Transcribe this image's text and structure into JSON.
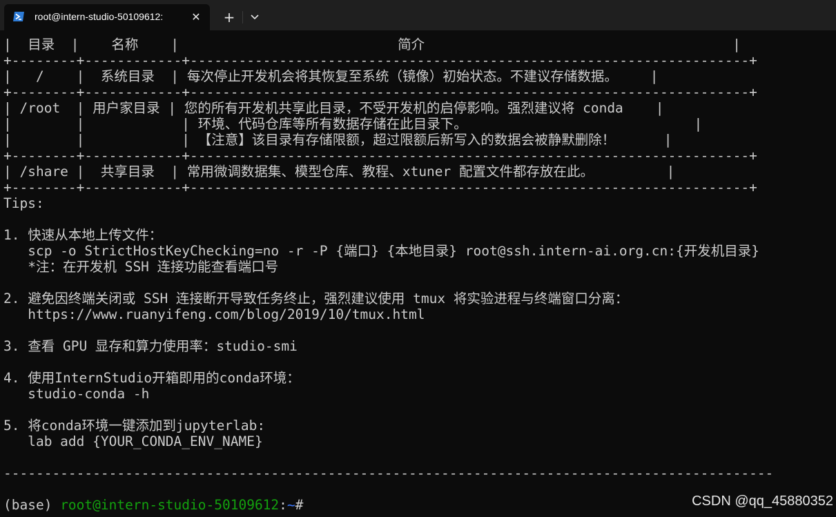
{
  "tab": {
    "icon": "powershell-icon",
    "title": "root@intern-studio-50109612:",
    "close": "✕",
    "new_tab": "+",
    "dropdown_icon": "chevron-down-icon"
  },
  "terminal": {
    "lines": [
      "|  目录  |    名称    |                           简介                                      |",
      "+--------+------------+---------------------------------------------------------------------+",
      "|   /    |  系统目录  | 每次停止开发机会将其恢复至系统（镜像）初始状态。不建议存储数据。    |",
      "+--------+------------+---------------------------------------------------------------------+",
      "| /root  | 用户家目录 | 您的所有开发机共享此目录，不受开发机的启停影响。强烈建议将 conda    |",
      "|        |            | 环境、代码仓库等所有数据存储在此目录下。                            |",
      "|        |            | 【注意】该目录有存储限额，超过限额后新写入的数据会被静默删除！      |",
      "+--------+------------+---------------------------------------------------------------------+",
      "| /share |  共享目录  | 常用微调数据集、模型仓库、教程、xtuner 配置文件都存放在此。         |",
      "+--------+------------+---------------------------------------------------------------------+",
      "Tips:",
      "",
      "1. 快速从本地上传文件：",
      "   scp -o StrictHostKeyChecking=no -r -P {端口} {本地目录} root@ssh.intern-ai.org.cn:{开发机目录}",
      "   *注：在开发机 SSH 连接功能查看端口号",
      "",
      "2. 避免因终端关闭或 SSH 连接断开导致任务终止，强烈建议使用 tmux 将实验进程与终端窗口分离：",
      "   https://www.ruanyifeng.com/blog/2019/10/tmux.html",
      "",
      "3. 查看 GPU 显存和算力使用率：studio-smi",
      "",
      "4. 使用InternStudio开箱即用的conda环境：",
      "   studio-conda -h",
      "",
      "5. 将conda环境一键添加到jupyterlab:",
      "   lab add {YOUR_CONDA_ENV_NAME}",
      "",
      "-----------------------------------------------------------------------------------------------",
      ""
    ],
    "prompt": {
      "env": "(base) ",
      "user_host": "root@intern-studio-50109612",
      "colon": ":",
      "path": "~",
      "symbol": "#"
    }
  },
  "watermark": "CSDN @qq_45880352",
  "colors": {
    "background": "#0c0c0c",
    "text": "#cccccc",
    "prompt_user": "#13a10e",
    "prompt_path": "#3b78ff"
  }
}
